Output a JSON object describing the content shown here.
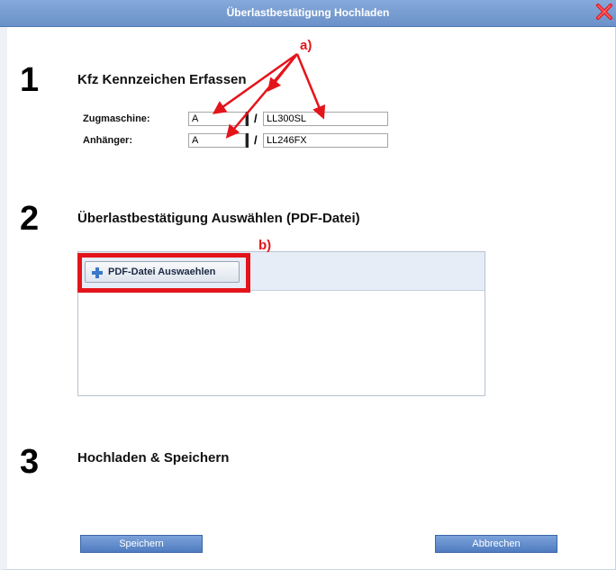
{
  "dialog": {
    "title": "Überlastbestätigung Hochladen",
    "close_icon": "close-icon"
  },
  "step1": {
    "number": "1",
    "title": "Kfz Kennzeichen Erfassen",
    "fields": [
      {
        "label": "Zugmaschine:",
        "prefix": "A",
        "plate": "LL300SL"
      },
      {
        "label": "Anhänger:",
        "prefix": "A",
        "plate": "LL246FX"
      }
    ],
    "separator": "/"
  },
  "step2": {
    "number": "2",
    "title": "Überlastbestätigung Auswählen (PDF-Datei)",
    "button_label": "PDF-Datei Auswaehlen",
    "button_icon": "plus-icon"
  },
  "step3": {
    "number": "3",
    "title": "Hochladen & Speichern"
  },
  "annotations": {
    "a": "a)",
    "b": "b)"
  },
  "actions": {
    "save": "Speichern",
    "cancel": "Abbrechen"
  },
  "colors": {
    "titlebar": "#6a91c9",
    "annotation_red": "#e4141b",
    "button_blue": "#4f7cc0"
  }
}
